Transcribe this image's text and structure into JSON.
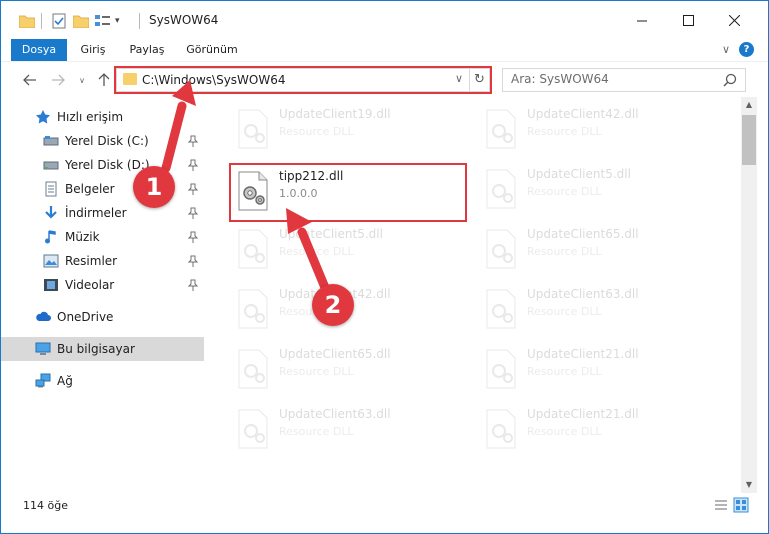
{
  "window": {
    "title": "SysWOW64"
  },
  "ribbon": {
    "tabs": [
      {
        "label": "Dosya",
        "active": true
      },
      {
        "label": "Giriş",
        "active": false
      },
      {
        "label": "Paylaş",
        "active": false
      },
      {
        "label": "Görünüm",
        "active": false
      }
    ],
    "help": "?"
  },
  "navigation": {
    "address_path": "C:\\Windows\\SysWOW64",
    "search_placeholder": "Ara: SysWOW64"
  },
  "sidebar": {
    "items": [
      {
        "label": "Hızlı erişim",
        "icon": "star-icon",
        "pinned": false
      },
      {
        "label": "Yerel Disk (C:)",
        "icon": "drive-icon",
        "pinned": true
      },
      {
        "label": "Yerel Disk (D:)",
        "icon": "drive-icon",
        "pinned": true
      },
      {
        "label": "Belgeler",
        "icon": "documents-icon",
        "pinned": true
      },
      {
        "label": "İndirmeler",
        "icon": "download-icon",
        "pinned": true
      },
      {
        "label": "Müzik",
        "icon": "music-icon",
        "pinned": true
      },
      {
        "label": "Resimler",
        "icon": "pictures-icon",
        "pinned": true
      },
      {
        "label": "Videolar",
        "icon": "videos-icon",
        "pinned": true
      },
      {
        "label": "OneDrive",
        "icon": "cloud-icon",
        "pinned": false
      },
      {
        "label": "Bu bilgisayar",
        "icon": "computer-icon",
        "pinned": false,
        "selected": true
      },
      {
        "label": "Ağ",
        "icon": "network-icon",
        "pinned": false
      }
    ]
  },
  "files": [
    {
      "name": "UpdateClient19.dll",
      "sub": "Resource DLL"
    },
    {
      "name": "UpdateClient42.dll",
      "sub": "Resource DLL"
    },
    {
      "name": "tipp212.dll",
      "sub": "1.0.0.0"
    },
    {
      "name": "UpdateClient5.dll",
      "sub": "Resource DLL"
    },
    {
      "name": "UpdateClient5.dll",
      "sub": "Resource DLL"
    },
    {
      "name": "UpdateClient65.dll",
      "sub": "Resource DLL"
    },
    {
      "name": "UpdateClient42.dll",
      "sub": "Resource DLL"
    },
    {
      "name": "UpdateClient63.dll",
      "sub": "Resource DLL"
    },
    {
      "name": "UpdateClient65.dll",
      "sub": "Resource DLL"
    },
    {
      "name": "UpdateClient21.dll",
      "sub": "Resource DLL"
    },
    {
      "name": "UpdateClient63.dll",
      "sub": "Resource DLL"
    },
    {
      "name": "UpdateClient21.dll",
      "sub": "Resource DLL"
    }
  ],
  "status": {
    "item_count": "114 öğe"
  },
  "annotations": {
    "step1": "1",
    "step2": "2"
  },
  "colors": {
    "accent": "#1979ca",
    "highlight": "#e0383e",
    "folder": "#f8d06b"
  }
}
